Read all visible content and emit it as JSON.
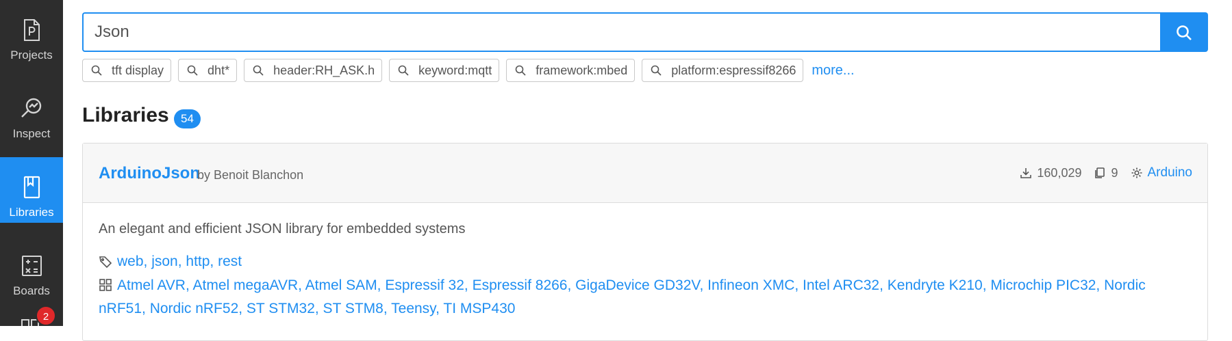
{
  "sidebar": {
    "items": [
      {
        "label": "Projects",
        "icon": "projects-file-icon",
        "active": false
      },
      {
        "label": "Inspect",
        "icon": "inspect-icon",
        "active": false
      },
      {
        "label": "Libraries",
        "icon": "libraries-book-icon",
        "active": true
      },
      {
        "label": "Boards",
        "icon": "boards-calculator-icon",
        "active": false
      },
      {
        "label": "",
        "icon": "platforms-grid-icon",
        "active": false
      }
    ],
    "notification_badge": "2"
  },
  "search": {
    "value": "Json",
    "button_icon": "search-icon"
  },
  "suggestions": {
    "chips": [
      "tft display",
      "dht*",
      "header:RH_ASK.h",
      "keyword:mqtt",
      "framework:mbed",
      "platform:espressif8266"
    ],
    "more_label": "more..."
  },
  "section": {
    "title": "Libraries",
    "count": "54"
  },
  "library": {
    "name": "ArduinoJson",
    "by_label": "by",
    "author": "Benoit Blanchon",
    "downloads": "160,029",
    "examples": "9",
    "framework": "Arduino",
    "description": "An elegant and efficient JSON library for embedded systems",
    "keywords": "web, json, http, rest",
    "platforms": "Atmel AVR, Atmel megaAVR, Atmel SAM, Espressif 32, Espressif 8266, GigaDevice GD32V, Infineon XMC, Intel ARC32, Kendryte K210, Microchip PIC32, Nordic nRF51, Nordic nRF52, ST STM32, ST STM8, Teensy, TI MSP430"
  },
  "colors": {
    "accent": "#1f8ef1",
    "sidebar_bg": "#2d2d2d",
    "badge_red": "#e0282a"
  }
}
